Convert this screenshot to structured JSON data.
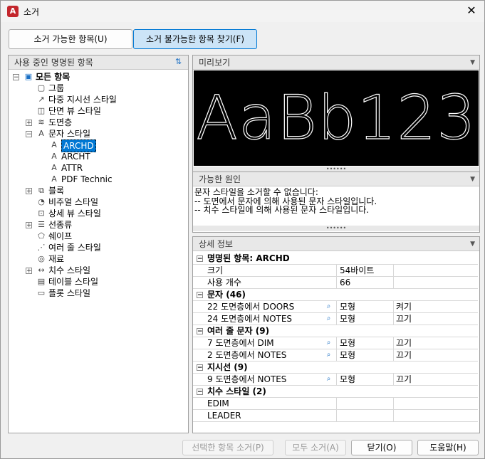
{
  "window": {
    "title": "소거",
    "app_icon": "A",
    "close_glyph": "✕"
  },
  "tabs": [
    {
      "label": "소거 가능한 항목(U)"
    },
    {
      "label": "소거 불가능한 항목 찾기(F)"
    }
  ],
  "tree_panel": {
    "title": "사용 중인 명명된 항목",
    "items": [
      {
        "label": "모든 항목",
        "icon": "drawing-icon"
      },
      {
        "label": "그룹",
        "icon": "group-icon"
      },
      {
        "label": "다중 지시선 스타일",
        "icon": "mleader-icon"
      },
      {
        "label": "단면 뷰 스타일",
        "icon": "section-view-icon"
      },
      {
        "label": "도면층",
        "icon": "layer-icon"
      },
      {
        "label": "문자 스타일",
        "icon": "text-style-icon"
      },
      {
        "label": "ARCHD",
        "icon": "text-style-icon"
      },
      {
        "label": "ARCHT",
        "icon": "text-style-icon"
      },
      {
        "label": "ATTR",
        "icon": "text-style-icon"
      },
      {
        "label": "PDF Technic",
        "icon": "text-style-icon"
      },
      {
        "label": "블록",
        "icon": "block-icon"
      },
      {
        "label": "비주얼 스타일",
        "icon": "visual-style-icon"
      },
      {
        "label": "상세 뷰 스타일",
        "icon": "detail-view-icon"
      },
      {
        "label": "선종류",
        "icon": "linetype-icon"
      },
      {
        "label": "쉐이프",
        "icon": "shape-icon"
      },
      {
        "label": "여러 줄 스타일",
        "icon": "mline-icon"
      },
      {
        "label": "재료",
        "icon": "material-icon"
      },
      {
        "label": "치수 스타일",
        "icon": "dim-style-icon"
      },
      {
        "label": "테이블 스타일",
        "icon": "table-style-icon"
      },
      {
        "label": "플롯 스타일",
        "icon": "plot-style-icon"
      }
    ]
  },
  "preview": {
    "title": "미리보기",
    "sample_text": "AaBb123"
  },
  "reason": {
    "title": "가능한 원인",
    "text": "문자 스타일을 소거할 수 없습니다:\n-- 도면에서 문자에 의해 사용된 문자 스타일입니다.\n-- 치수 스타일에 의해 사용된 문자 스타일입니다."
  },
  "details": {
    "title": "상세 정보",
    "rows": [
      {
        "type": "group",
        "label": "명명된 항목: ARCHD"
      },
      {
        "type": "row",
        "c1": "크기",
        "c2": "54바이트",
        "c3": ""
      },
      {
        "type": "row",
        "c1": "사용 개수",
        "c2": "66",
        "c3": ""
      },
      {
        "type": "group",
        "label": "문자 (46)"
      },
      {
        "type": "row",
        "c1": "22 도면층에서 DOORS",
        "c2": "모형",
        "c3": "켜기",
        "zoom": true
      },
      {
        "type": "row",
        "c1": "24 도면층에서 NOTES",
        "c2": "모형",
        "c3": "끄기",
        "zoom": true
      },
      {
        "type": "group",
        "label": "여러 줄 문자 (9)"
      },
      {
        "type": "row",
        "c1": "7 도면층에서 DIM",
        "c2": "모형",
        "c3": "끄기",
        "zoom": true
      },
      {
        "type": "row",
        "c1": "2 도면층에서 NOTES",
        "c2": "모형",
        "c3": "끄기",
        "zoom": true
      },
      {
        "type": "group",
        "label": "지시선 (9)"
      },
      {
        "type": "row",
        "c1": "9 도면층에서 NOTES",
        "c2": "모형",
        "c3": "끄기",
        "zoom": true
      },
      {
        "type": "group",
        "label": "치수 스타일 (2)"
      },
      {
        "type": "row",
        "c1": "EDIM",
        "c2": "",
        "c3": ""
      },
      {
        "type": "row",
        "c1": "LEADER",
        "c2": "",
        "c3": ""
      }
    ]
  },
  "footer": {
    "purge_selected": "선택한 항목 소거(P)",
    "purge_all": "모두 소거(A)",
    "close": "닫기(O)",
    "help": "도움말(H)"
  }
}
